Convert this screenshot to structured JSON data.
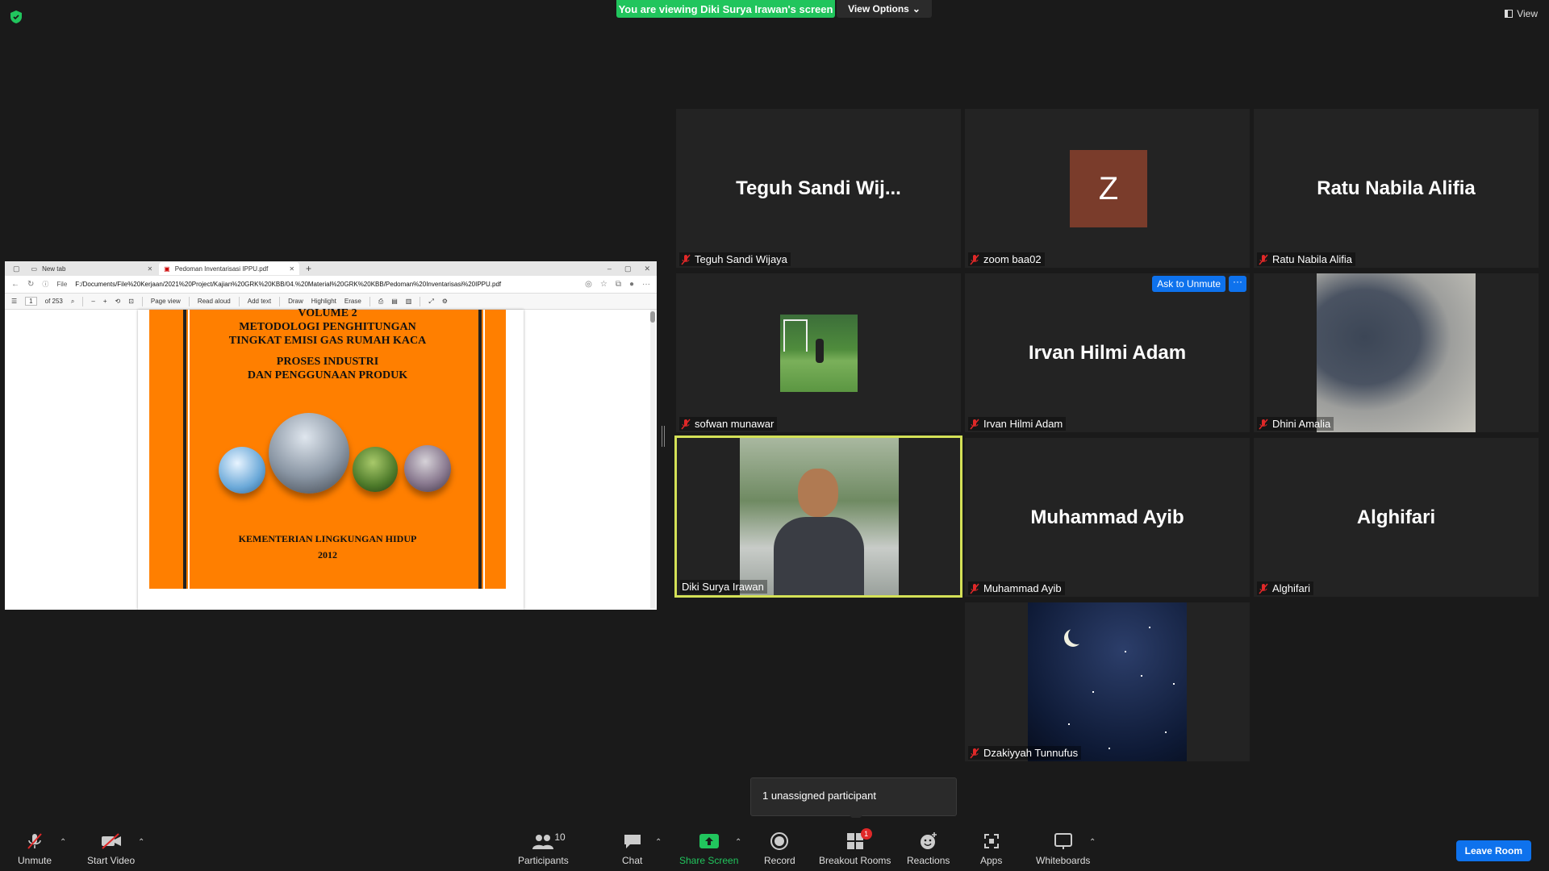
{
  "header": {
    "banner": "You are viewing Diki Surya Irawan's screen",
    "view_options": "View Options",
    "view": "View"
  },
  "shared_screen": {
    "tabs": [
      {
        "label": "New tab"
      },
      {
        "label": "Pedoman Inventarisasi IPPU.pdf"
      }
    ],
    "address": "F:/Documents/File%20Kerjaan/2021%20Project/Kajian%20GRK%20KBB/04.%20Material%20GRK%20KBB/Pedoman%20Inventarisasi%20IPPU.pdf",
    "address_prefix": "File",
    "pdf_toolbar": {
      "page": "1",
      "of_pages": "of 253",
      "page_view": "Page view",
      "read_aloud": "Read aloud",
      "add_text": "Add text",
      "draw": "Draw",
      "highlight": "Highlight",
      "erase": "Erase"
    },
    "cover": {
      "line1": "VOLUME 2",
      "line2": "METODOLOGI PENGHITUNGAN",
      "line3": "TINGKAT EMISI GAS RUMAH KACA",
      "line4": "PROSES INDUSTRI",
      "line5": "DAN PENGGUNAAN PRODUK",
      "line6": "KEMENTERIAN LINGKUNGAN HIDUP",
      "line7": "2012"
    }
  },
  "tiles": [
    {
      "big": "Teguh Sandi Wij...",
      "label": "Teguh Sandi Wijaya"
    },
    {
      "avatar": "Z",
      "label": "zoom baa02"
    },
    {
      "big": "Ratu Nabila Alifia",
      "label": "Ratu Nabila Alifia"
    },
    {
      "label": "sofwan munawar"
    },
    {
      "big": "Irvan Hilmi Adam",
      "label": "Irvan Hilmi Adam",
      "ask_unmute": "Ask to Unmute",
      "more": "···"
    },
    {
      "label": "Dhini Amalia"
    },
    {
      "label": "Diki Surya Irawan"
    },
    {
      "big": "Muhammad Ayib",
      "label": "Muhammad Ayib"
    },
    {
      "big": "Alghifari",
      "label": "Alghifari"
    },
    {
      "label": "Dzakiyyah Tunnufus"
    }
  ],
  "unassigned": "1 unassigned participant",
  "toolbar": {
    "unmute": "Unmute",
    "start_video": "Start Video",
    "participants": "Participants",
    "participants_count": "10",
    "chat": "Chat",
    "share_screen": "Share Screen",
    "record": "Record",
    "breakout_rooms": "Breakout Rooms",
    "breakout_badge": "1",
    "reactions": "Reactions",
    "apps": "Apps",
    "whiteboards": "Whiteboards",
    "leave_room": "Leave Room"
  },
  "colors": {
    "banner_green": "#21c55d",
    "accent_blue": "#0e72ed",
    "cover_orange": "#ff7f00",
    "speaker_border": "#d4e157"
  }
}
